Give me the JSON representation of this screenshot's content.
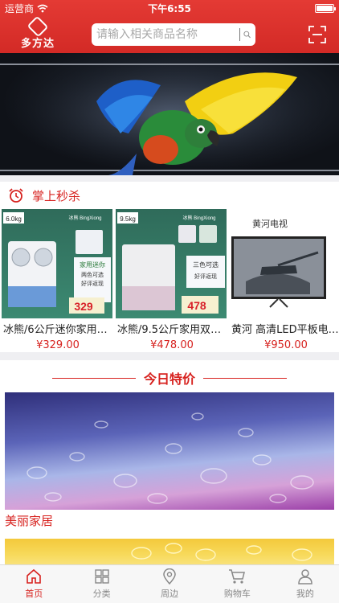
{
  "status": {
    "carrier": "运营商",
    "time": "下午6:55"
  },
  "header": {
    "logo_text": "多方达",
    "search_placeholder": "请输入相关商品名称"
  },
  "flash_sale": {
    "title": "掌上秒杀",
    "products": [
      {
        "name": "冰熊/6公斤迷你家用双缸...",
        "price": "¥329.00",
        "tag": "6.0kg",
        "brand": "冰熊 BingXiong",
        "ad_price": "329",
        "ad_lines": [
          "家用迷你",
          "两色可选",
          "好评返现"
        ]
      },
      {
        "name": "冰熊/9.5公斤家用双缸半...",
        "price": "¥478.00",
        "tag": "9.5kg",
        "brand": "冰熊 BingXiong",
        "ad_price": "478",
        "ad_lines": [
          "三色可选",
          "好评返现"
        ]
      },
      {
        "name": "黄河 高清LED平板电视...",
        "price": "¥950.00",
        "brand": "黄河电视"
      }
    ]
  },
  "special": {
    "title": "今日特价",
    "items": [
      {
        "caption": "美丽家居"
      }
    ]
  },
  "tabs": [
    {
      "label": "首页",
      "icon": "home-icon",
      "active": true
    },
    {
      "label": "分类",
      "icon": "grid-icon",
      "active": false
    },
    {
      "label": "周边",
      "icon": "location-icon",
      "active": false
    },
    {
      "label": "购物车",
      "icon": "cart-icon",
      "active": false
    },
    {
      "label": "我的",
      "icon": "user-icon",
      "active": false
    }
  ],
  "colors": {
    "brand_red": "#d7221f",
    "header_red": "#e03530",
    "tab_inactive": "#888888"
  }
}
